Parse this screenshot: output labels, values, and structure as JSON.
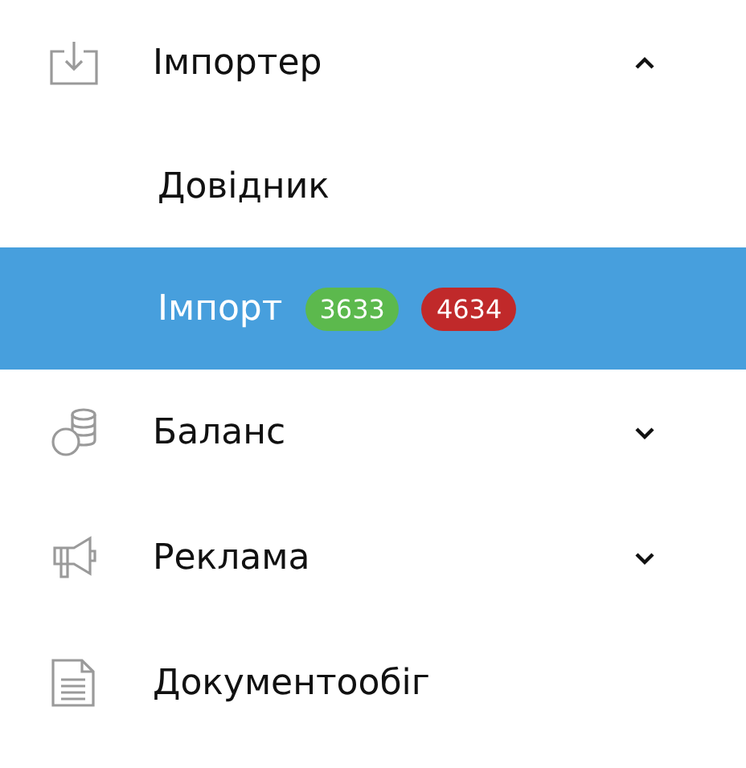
{
  "menu": [
    {
      "kind": "import",
      "label": "Імпортер",
      "expanded": true,
      "children": [
        {
          "label": "Довідник",
          "selected": false
        },
        {
          "label": "Імпорт",
          "selected": true,
          "badges": [
            {
              "text": "3633",
              "color": "#5cb94d"
            },
            {
              "text": "4634",
              "color": "#c0292a"
            }
          ]
        }
      ]
    },
    {
      "kind": "coins",
      "label": "Баланс",
      "expanded": false
    },
    {
      "kind": "megaphone",
      "label": "Реклама",
      "expanded": false
    },
    {
      "kind": "document",
      "label": "Документообіг"
    }
  ]
}
